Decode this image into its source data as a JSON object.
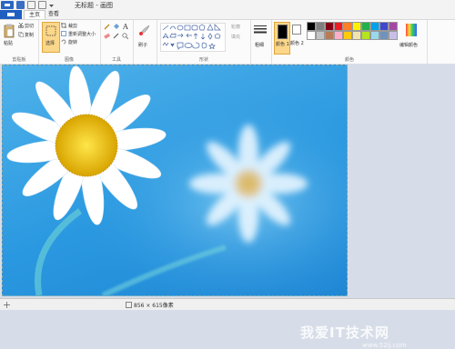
{
  "window": {
    "title": "无标题 - 画图"
  },
  "tabs": {
    "home": "主页",
    "view": "查看"
  },
  "ribbon": {
    "clipboard": {
      "paste": "粘贴",
      "cut": "剪切",
      "copy": "复制",
      "group": "剪贴板"
    },
    "image": {
      "select": "选择",
      "crop": "裁剪",
      "resize": "重新调整大小",
      "rotate": "旋转",
      "group": "图像"
    },
    "tools": {
      "group": "工具"
    },
    "brushes": {
      "label": "刷子"
    },
    "shapes": {
      "outline": "轮廓",
      "fill": "填充",
      "group": "形状"
    },
    "size": {
      "label": "粗细"
    },
    "colors": {
      "color1": "颜色 1",
      "color2": "颜色 2",
      "edit": "编辑颜色",
      "group": "颜色",
      "palette_row1": [
        "#000000",
        "#7f7f7f",
        "#880015",
        "#ed1c24",
        "#ff7f27",
        "#fff200",
        "#22b14c",
        "#00a2e8",
        "#3f48cc",
        "#a349a4"
      ],
      "palette_row2": [
        "#ffffff",
        "#c3c3c3",
        "#b97a57",
        "#ffaec9",
        "#ffc90e",
        "#efe4b0",
        "#b5e61d",
        "#99d9ea",
        "#7092be",
        "#c8bfe7"
      ]
    }
  },
  "status": {
    "dimensions": "856 × 615像素"
  },
  "watermark": {
    "text": "我爱IT技术网",
    "url": "www.52ij.com"
  }
}
